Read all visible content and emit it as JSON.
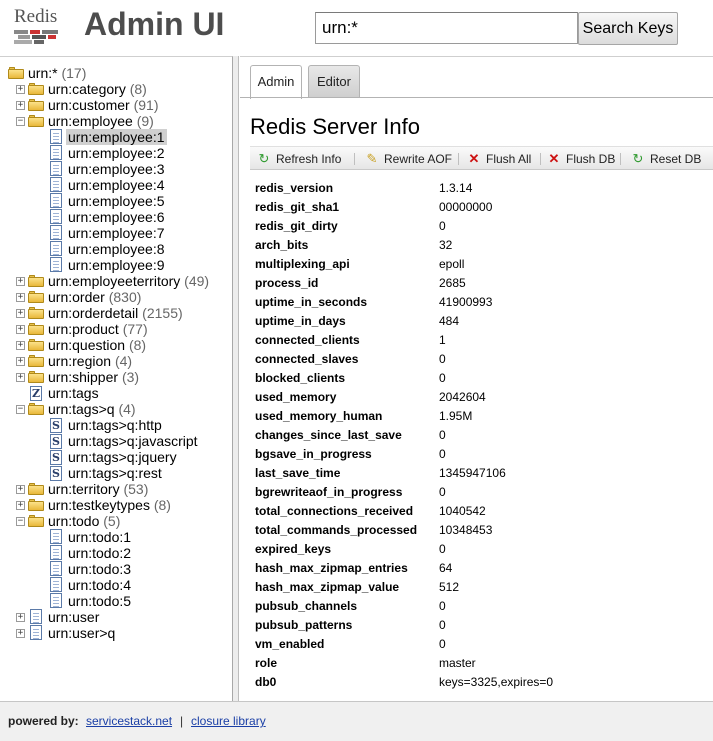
{
  "header": {
    "logo_text": "Redis",
    "app_title": "Admin UI",
    "search_value": "urn:*",
    "search_button": "Search Keys"
  },
  "tree": [
    {
      "label": "urn:*",
      "count": "(17)",
      "kind": "folder",
      "depth": 0,
      "expander": "",
      "open": true
    },
    {
      "label": "urn:category",
      "count": "(8)",
      "kind": "folder",
      "depth": 1,
      "expander": "+"
    },
    {
      "label": "urn:customer",
      "count": "(91)",
      "kind": "folder",
      "depth": 1,
      "expander": "+"
    },
    {
      "label": "urn:employee",
      "count": "(9)",
      "kind": "folder",
      "depth": 1,
      "expander": "-",
      "open": true
    },
    {
      "label": "urn:employee:1",
      "count": "",
      "kind": "doc",
      "depth": 2,
      "selected": true
    },
    {
      "label": "urn:employee:2",
      "count": "",
      "kind": "doc",
      "depth": 2
    },
    {
      "label": "urn:employee:3",
      "count": "",
      "kind": "doc",
      "depth": 2
    },
    {
      "label": "urn:employee:4",
      "count": "",
      "kind": "doc",
      "depth": 2
    },
    {
      "label": "urn:employee:5",
      "count": "",
      "kind": "doc",
      "depth": 2
    },
    {
      "label": "urn:employee:6",
      "count": "",
      "kind": "doc",
      "depth": 2
    },
    {
      "label": "urn:employee:7",
      "count": "",
      "kind": "doc",
      "depth": 2
    },
    {
      "label": "urn:employee:8",
      "count": "",
      "kind": "doc",
      "depth": 2
    },
    {
      "label": "urn:employee:9",
      "count": "",
      "kind": "doc",
      "depth": 2
    },
    {
      "label": "urn:employeeterritory",
      "count": "(49)",
      "kind": "folder",
      "depth": 1,
      "expander": "+"
    },
    {
      "label": "urn:order",
      "count": "(830)",
      "kind": "folder",
      "depth": 1,
      "expander": "+"
    },
    {
      "label": "urn:orderdetail",
      "count": "(2155)",
      "kind": "folder",
      "depth": 1,
      "expander": "+"
    },
    {
      "label": "urn:product",
      "count": "(77)",
      "kind": "folder",
      "depth": 1,
      "expander": "+"
    },
    {
      "label": "urn:question",
      "count": "(8)",
      "kind": "folder",
      "depth": 1,
      "expander": "+"
    },
    {
      "label": "urn:region",
      "count": "(4)",
      "kind": "folder",
      "depth": 1,
      "expander": "+"
    },
    {
      "label": "urn:shipper",
      "count": "(3)",
      "kind": "folder",
      "depth": 1,
      "expander": "+"
    },
    {
      "label": "urn:tags",
      "count": "",
      "kind": "zset",
      "glyph": "Z",
      "depth": 1
    },
    {
      "label": "urn:tags>q",
      "count": "(4)",
      "kind": "folder",
      "depth": 1,
      "expander": "-",
      "open": true
    },
    {
      "label": "urn:tags>q:http",
      "count": "",
      "kind": "set",
      "glyph": "S",
      "depth": 2
    },
    {
      "label": "urn:tags>q:javascript",
      "count": "",
      "kind": "set",
      "glyph": "S",
      "depth": 2
    },
    {
      "label": "urn:tags>q:jquery",
      "count": "",
      "kind": "set",
      "glyph": "S",
      "depth": 2
    },
    {
      "label": "urn:tags>q:rest",
      "count": "",
      "kind": "set",
      "glyph": "S",
      "depth": 2
    },
    {
      "label": "urn:territory",
      "count": "(53)",
      "kind": "folder",
      "depth": 1,
      "expander": "+"
    },
    {
      "label": "urn:testkeytypes",
      "count": "(8)",
      "kind": "folder",
      "depth": 1,
      "expander": "+"
    },
    {
      "label": "urn:todo",
      "count": "(5)",
      "kind": "folder",
      "depth": 1,
      "expander": "-",
      "open": true
    },
    {
      "label": "urn:todo:1",
      "count": "",
      "kind": "doc",
      "depth": 2
    },
    {
      "label": "urn:todo:2",
      "count": "",
      "kind": "doc",
      "depth": 2
    },
    {
      "label": "urn:todo:3",
      "count": "",
      "kind": "doc",
      "depth": 2
    },
    {
      "label": "urn:todo:4",
      "count": "",
      "kind": "doc",
      "depth": 2
    },
    {
      "label": "urn:todo:5",
      "count": "",
      "kind": "doc",
      "depth": 2
    },
    {
      "label": "urn:user",
      "count": "",
      "kind": "doc",
      "depth": 1,
      "expander": "+"
    },
    {
      "label": "urn:user>q",
      "count": "",
      "kind": "doc",
      "depth": 1,
      "expander": "+"
    }
  ],
  "tabs": [
    {
      "label": "Admin",
      "active": true
    },
    {
      "label": "Editor",
      "active": false
    }
  ],
  "page_title": "Redis Server Info",
  "toolbar": [
    {
      "label": "Refresh Info",
      "icon": "refresh-icon"
    },
    {
      "label": "Rewrite AOF",
      "icon": "pencil-icon"
    },
    {
      "label": "Flush All",
      "icon": "x-icon"
    },
    {
      "label": "Flush DB",
      "icon": "x-icon"
    },
    {
      "label": "Reset DB",
      "icon": "refresh-icon"
    }
  ],
  "server_info": [
    [
      "redis_version",
      "1.3.14"
    ],
    [
      "redis_git_sha1",
      "00000000"
    ],
    [
      "redis_git_dirty",
      "0"
    ],
    [
      "arch_bits",
      "32"
    ],
    [
      "multiplexing_api",
      "epoll"
    ],
    [
      "process_id",
      "2685"
    ],
    [
      "uptime_in_seconds",
      "41900993"
    ],
    [
      "uptime_in_days",
      "484"
    ],
    [
      "connected_clients",
      "1"
    ],
    [
      "connected_slaves",
      "0"
    ],
    [
      "blocked_clients",
      "0"
    ],
    [
      "used_memory",
      "2042604"
    ],
    [
      "used_memory_human",
      "1.95M"
    ],
    [
      "changes_since_last_save",
      "0"
    ],
    [
      "bgsave_in_progress",
      "0"
    ],
    [
      "last_save_time",
      "1345947106"
    ],
    [
      "bgrewriteaof_in_progress",
      "0"
    ],
    [
      "total_connections_received",
      "1040542"
    ],
    [
      "total_commands_processed",
      "10348453"
    ],
    [
      "expired_keys",
      "0"
    ],
    [
      "hash_max_zipmap_entries",
      "64"
    ],
    [
      "hash_max_zipmap_value",
      "512"
    ],
    [
      "pubsub_channels",
      "0"
    ],
    [
      "pubsub_patterns",
      "0"
    ],
    [
      "vm_enabled",
      "0"
    ],
    [
      "role",
      "master"
    ],
    [
      "db0",
      "keys=3325,expires=0"
    ]
  ],
  "footer": {
    "powered_by": "powered by:",
    "link1": "servicestack.net",
    "separator": "|",
    "link2": "closure library"
  },
  "colors": {
    "title": "#4d4d4d",
    "link": "#1a3fa6",
    "selected_bg": "#d0d0d0",
    "flush_x": "#cc1111",
    "refresh": "#2f9a2f"
  }
}
